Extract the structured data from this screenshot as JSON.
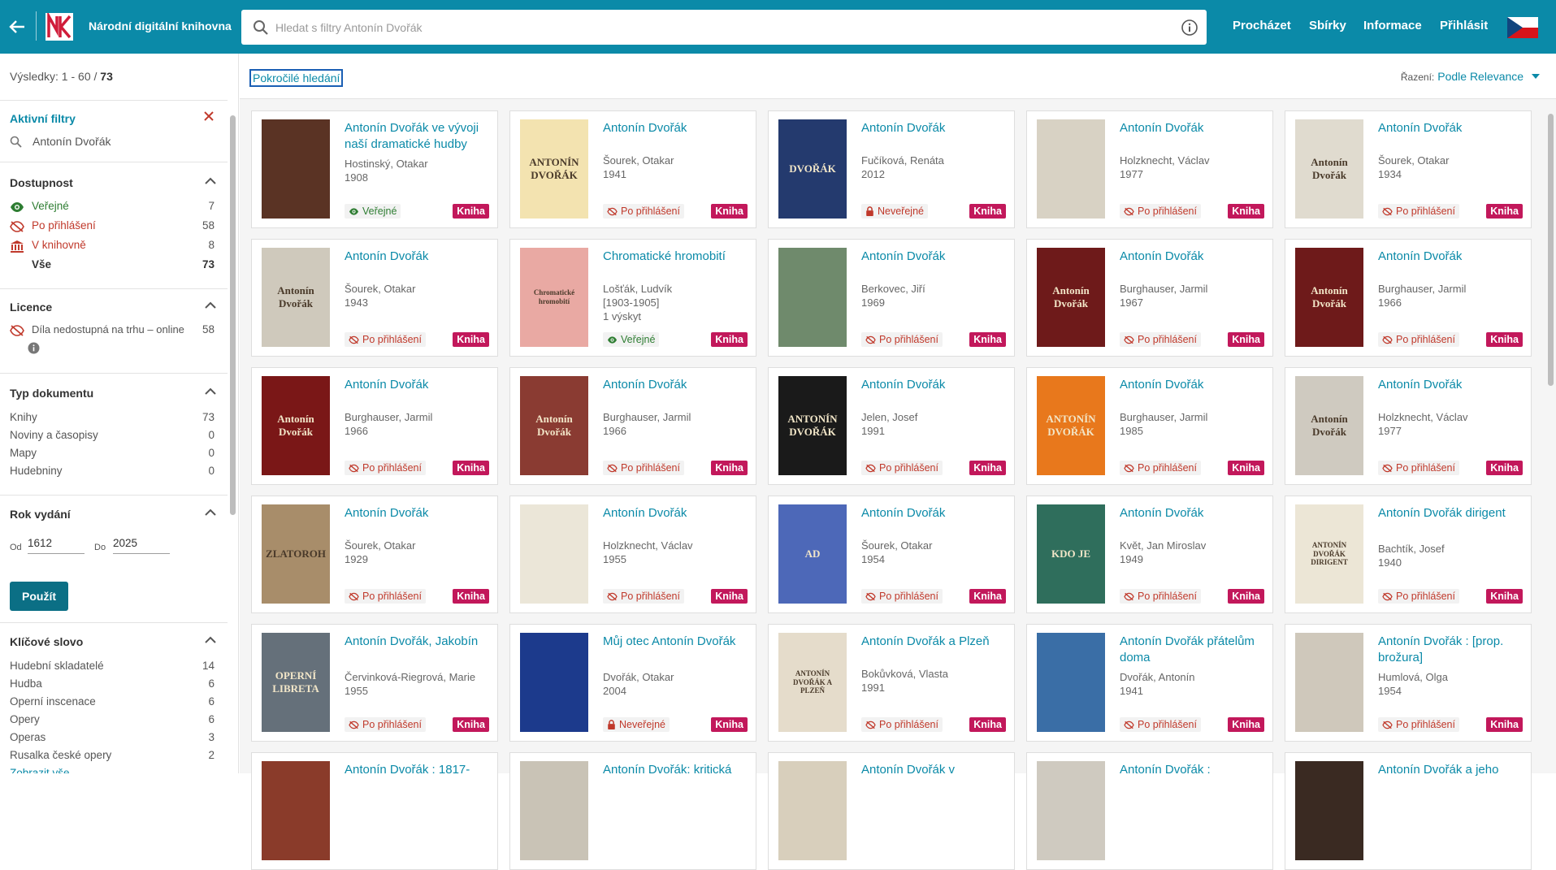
{
  "header": {
    "brand": "Národní digitální knihovna",
    "search_placeholder": "Hledat s filtry Antonín Dvořák",
    "nav": [
      "Procházet",
      "Sbírky",
      "Informace",
      "Přihlásit"
    ],
    "colors": {
      "bar": "#0b8aa8",
      "accent": "#c2185b"
    }
  },
  "sidebar": {
    "results_label": "Výsledky: 1 - 60 / ",
    "results_total": "73",
    "active_filters": {
      "title": "Aktivní filtry",
      "query": "Antonín Dvořák"
    },
    "availability": {
      "title": "Dostupnost",
      "items": [
        {
          "label": "Veřejné",
          "count": "7"
        },
        {
          "label": "Po přihlášení",
          "count": "58"
        },
        {
          "label": "V knihovně",
          "count": "8"
        },
        {
          "label": "Vše",
          "count": "73"
        }
      ]
    },
    "license": {
      "title": "Licence",
      "items": [
        {
          "label": "Díla nedostupná na trhu – online",
          "count": "58"
        }
      ]
    },
    "doc_type": {
      "title": "Typ dokumentu",
      "items": [
        {
          "label": "Knihy",
          "count": "73"
        },
        {
          "label": "Noviny a časopisy",
          "count": "0"
        },
        {
          "label": "Mapy",
          "count": "0"
        },
        {
          "label": "Hudebniny",
          "count": "0"
        }
      ]
    },
    "year": {
      "title": "Rok vydání",
      "from_label": "Od",
      "from": "1612",
      "to_label": "Do",
      "to": "2025",
      "apply": "Použít"
    },
    "keywords": {
      "title": "Klíčové slovo",
      "items": [
        {
          "label": "Hudební skladatelé",
          "count": "14"
        },
        {
          "label": "Hudba",
          "count": "6"
        },
        {
          "label": "Operní inscenace",
          "count": "6"
        },
        {
          "label": "Opery",
          "count": "6"
        },
        {
          "label": "Operas",
          "count": "3"
        },
        {
          "label": "Rusalka české opery",
          "count": "2"
        },
        {
          "label": "Zobrazit vše",
          "count": ""
        }
      ]
    }
  },
  "main": {
    "advanced_search": "Pokročilé hledání",
    "sort_label": "Řazení:",
    "sort_value": "Podle Relevance",
    "type_label": "Kniha",
    "access_labels": {
      "public": "Veřejné",
      "login": "Po přihlášení",
      "private": "Neveřejné"
    },
    "cards": [
      {
        "title": "Antonín Dvořák ve vývoji naší dramatické hudby",
        "author": "Hostinský, Otakar",
        "year": "1908",
        "extra": "",
        "access": "Veřejné",
        "access_kind": "public",
        "cover_color": "#5a3324",
        "cover_text": ""
      },
      {
        "title": "Antonín Dvořák",
        "author": "Šourek, Otakar",
        "year": "1941",
        "extra": "",
        "access": "Po přihlášení",
        "access_kind": "login",
        "cover_color": "#f3e3b0",
        "cover_text": "ANTONÍN DVOŘÁK"
      },
      {
        "title": "Antonín Dvořák",
        "author": "Fučíková, Renáta",
        "year": "2012",
        "extra": "",
        "access": "Neveřejné",
        "access_kind": "private",
        "cover_color": "#243a6e",
        "cover_text": "DVOŘÁK"
      },
      {
        "title": "Antonín Dvořák",
        "author": "Holzknecht, Václav",
        "year": "1977",
        "extra": "",
        "access": "Po přihlášení",
        "access_kind": "login",
        "cover_color": "#d8d2c4",
        "cover_text": ""
      },
      {
        "title": "Antonín Dvořák",
        "author": "Šourek, Otakar",
        "year": "1934",
        "extra": "",
        "access": "Po přihlášení",
        "access_kind": "login",
        "cover_color": "#e0dbcf",
        "cover_text": "Antonín Dvořák"
      },
      {
        "title": "Antonín Dvořák",
        "author": "Šourek, Otakar",
        "year": "1943",
        "extra": "",
        "access": "Po přihlášení",
        "access_kind": "login",
        "cover_color": "#cfc9bc",
        "cover_text": "Antonín Dvořák"
      },
      {
        "title": "Chromatické hromobití",
        "author": "Lošťák, Ludvík",
        "year": "[1903-1905]",
        "extra": "1 výskyt",
        "access": "Veřejné",
        "access_kind": "public",
        "cover_color": "#e9a9a3",
        "cover_text": "Chromatické hromobití"
      },
      {
        "title": "Antonín Dvořák",
        "author": "Berkovec, Jiří",
        "year": "1969",
        "extra": "",
        "access": "Po přihlášení",
        "access_kind": "login",
        "cover_color": "#6f8a6c",
        "cover_text": ""
      },
      {
        "title": "Antonín Dvořák",
        "author": "Burghauser, Jarmil",
        "year": "1967",
        "extra": "",
        "access": "Po přihlášení",
        "access_kind": "login",
        "cover_color": "#6e1a1a",
        "cover_text": "Antonín Dvořák"
      },
      {
        "title": "Antonín Dvořák",
        "author": "Burghauser, Jarmil",
        "year": "1966",
        "extra": "",
        "access": "Po přihlášení",
        "access_kind": "login",
        "cover_color": "#6e1a1a",
        "cover_text": "Antonín Dvořák"
      },
      {
        "title": "Antonín Dvořák",
        "author": "Burghauser, Jarmil",
        "year": "1966",
        "extra": "",
        "access": "Po přihlášení",
        "access_kind": "login",
        "cover_color": "#7a1717",
        "cover_text": "Antonín Dvořák"
      },
      {
        "title": "Antonín Dvořák",
        "author": "Burghauser, Jarmil",
        "year": "1966",
        "extra": "",
        "access": "Po přihlášení",
        "access_kind": "login",
        "cover_color": "#8a3b32",
        "cover_text": "Antonín Dvořák"
      },
      {
        "title": "Antonín Dvořák",
        "author": "Jelen, Josef",
        "year": "1991",
        "extra": "",
        "access": "Po přihlášení",
        "access_kind": "login",
        "cover_color": "#1a1a1a",
        "cover_text": "ANTONÍN DVOŘÁK"
      },
      {
        "title": "Antonín Dvořák",
        "author": "Burghauser, Jarmil",
        "year": "1985",
        "extra": "",
        "access": "Po přihlášení",
        "access_kind": "login",
        "cover_color": "#e8781c",
        "cover_text": "ANTONÍN DVOŘÁK"
      },
      {
        "title": "Antonín Dvořák",
        "author": "Holzknecht, Václav",
        "year": "1977",
        "extra": "",
        "access": "Po přihlášení",
        "access_kind": "login",
        "cover_color": "#cfcac0",
        "cover_text": "Antonín Dvořák"
      },
      {
        "title": "Antonín Dvořák",
        "author": "Šourek, Otakar",
        "year": "1929",
        "extra": "",
        "access": "Po přihlášení",
        "access_kind": "login",
        "cover_color": "#a88d6a",
        "cover_text": "ZLATOROH"
      },
      {
        "title": "Antonín Dvořák",
        "author": "Holzknecht, Václav",
        "year": "1955",
        "extra": "",
        "access": "Po přihlášení",
        "access_kind": "login",
        "cover_color": "#ebe6d8",
        "cover_text": ""
      },
      {
        "title": "Antonín Dvořák",
        "author": "Šourek, Otakar",
        "year": "1954",
        "extra": "",
        "access": "Po přihlášení",
        "access_kind": "login",
        "cover_color": "#4d68b8",
        "cover_text": "AD"
      },
      {
        "title": "Antonín Dvořák",
        "author": "Květ, Jan Miroslav",
        "year": "1949",
        "extra": "",
        "access": "Po přihlášení",
        "access_kind": "login",
        "cover_color": "#2f6e5c",
        "cover_text": "KDO JE"
      },
      {
        "title": "Antonín Dvořák dirigent",
        "author": "Bachtík, Josef",
        "year": "1940",
        "extra": "",
        "access": "Po přihlášení",
        "access_kind": "login",
        "cover_color": "#ece6d6",
        "cover_text": "ANTONÍN DVOŘÁK DIRIGENT"
      },
      {
        "title": "Antonín Dvořák, Jakobín",
        "author": "Červinková-Riegrová, Marie",
        "year": "1955",
        "extra": "",
        "access": "Po přihlášení",
        "access_kind": "login",
        "cover_color": "#65707a",
        "cover_text": "OPERNÍ LIBRETA"
      },
      {
        "title": "Můj otec Antonín Dvořák",
        "author": "Dvořák, Otakar",
        "year": "2004",
        "extra": "",
        "access": "Neveřejné",
        "access_kind": "private",
        "cover_color": "#1c3a8c",
        "cover_text": ""
      },
      {
        "title": "Antonín Dvořák a Plzeň",
        "author": "Bokůvková, Vlasta",
        "year": "1991",
        "extra": "",
        "access": "Po přihlášení",
        "access_kind": "login",
        "cover_color": "#e5dccb",
        "cover_text": "ANTONÍN DVOŘÁK A PLZEŇ"
      },
      {
        "title": "Antonín Dvořák přátelům doma",
        "author": "Dvořák, Antonín",
        "year": "1941",
        "extra": "",
        "access": "Po přihlášení",
        "access_kind": "login",
        "cover_color": "#3a6ea6",
        "cover_text": ""
      },
      {
        "title": "Antonín Dvořák : [prop. brožura]",
        "author": "Humlová, Olga",
        "year": "1954",
        "extra": "",
        "access": "Po přihlášení",
        "access_kind": "login",
        "cover_color": "#cfc8bb",
        "cover_text": ""
      },
      {
        "title": "Antonín Dvořák : 1817-",
        "author": "",
        "year": "",
        "extra": "",
        "access": "",
        "access_kind": "",
        "cover_color": "#8a3b2a",
        "cover_text": ""
      },
      {
        "title": "Antonín Dvořák: kritická",
        "author": "",
        "year": "",
        "extra": "",
        "access": "",
        "access_kind": "",
        "cover_color": "#c9c3b6",
        "cover_text": ""
      },
      {
        "title": "Antonín Dvořák v",
        "author": "",
        "year": "",
        "extra": "",
        "access": "",
        "access_kind": "",
        "cover_color": "#d8cfbc",
        "cover_text": ""
      },
      {
        "title": "Antonín Dvořák :",
        "author": "",
        "year": "",
        "extra": "",
        "access": "",
        "access_kind": "",
        "cover_color": "#cfcac0",
        "cover_text": ""
      },
      {
        "title": "Antonín Dvořák a jeho",
        "author": "",
        "year": "",
        "extra": "",
        "access": "",
        "access_kind": "",
        "cover_color": "#3a2a22",
        "cover_text": ""
      }
    ]
  }
}
